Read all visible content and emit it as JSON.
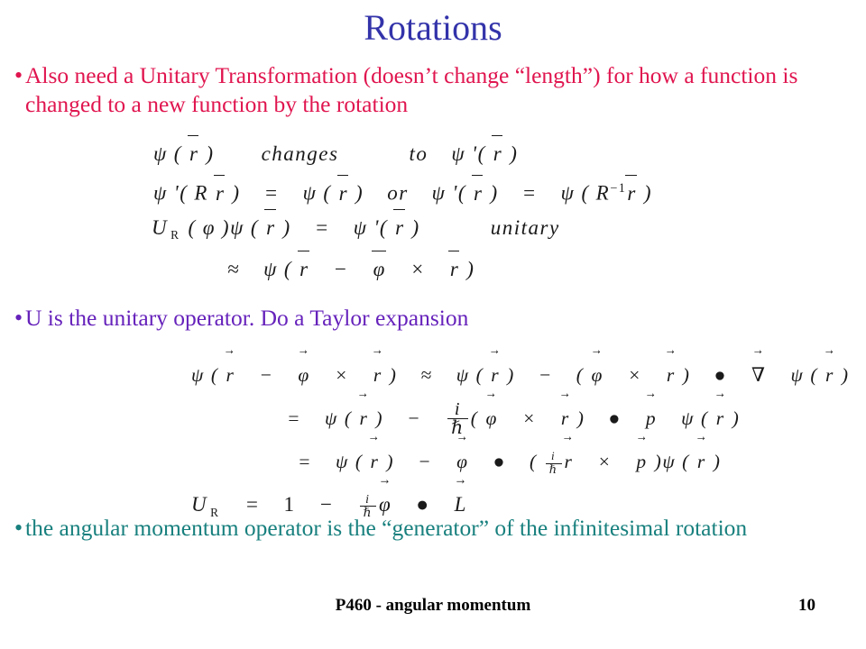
{
  "slide": {
    "title": "Rotations",
    "title_color": "#3333AA",
    "background_color": "#FFFFFF",
    "page_number": "10",
    "footer": "P460 - angular momentum"
  },
  "bullets": [
    {
      "marker": "•",
      "color": "#E0154F",
      "text": "Also need a Unitary Transformation (doesn’t change “length”) for how a function is changed to a new function by the rotation"
    },
    {
      "marker": "•",
      "color": "#6622BB",
      "text": "U is the unitary operator. Do a Taylor expansion"
    },
    {
      "marker": "•",
      "color": "#18807E",
      "text": "the angular momentum operator is the “generator” of the infinitesimal rotation"
    }
  ],
  "equation_block_1": {
    "color": "#1A1A1A",
    "lines": [
      "ψ ( r̅ )  changes   to  ψ '( r̅ )",
      "ψ '( R r̅ ) = ψ ( r̅ ) or ψ '( r̅ ) = ψ ( R ⁻¹ r̅ )",
      "U R ( φ )ψ ( r̅ ) = ψ '( r̅ )   unitary",
      "≈ ψ ( r̅ − φ̅ × r̅ )"
    ],
    "symbols": {
      "psi": "ψ",
      "phi": "φ",
      "r": "r",
      "approx": "≈",
      "times": "×",
      "minus": "−",
      "equals": "=",
      "prime": "'",
      "inverse_exponent": "− 1",
      "subscript_R": "R",
      "word_changes": "changes",
      "word_to": "to",
      "word_or": "or",
      "word_unitary": "unitary"
    }
  },
  "equation_block_2": {
    "color": "#1A1A1A",
    "lines": [
      "ψ ( r⃗ − φ⃗ × r⃗ ) ≈ ψ ( r⃗ ) − ( φ⃗ × r⃗ ) • ∇⃗ ψ ( r⃗ )",
      "= ψ ( r⃗ ) − (i/ħ)( φ⃗ × r⃗ ) • p⃗ ψ ( r⃗ )",
      "= ψ ( r⃗ ) − φ⃗ • ( (i/ħ) r⃗ × p⃗ )ψ ( r⃗ )",
      "U R = 1 − (i/ħ) φ⃗ • L⃗"
    ],
    "symbols": {
      "psi": "ψ",
      "phi": "φ",
      "r": "r",
      "p": "p",
      "L": "L",
      "U": "U",
      "one": "1",
      "i": "i",
      "hbar": "ħ",
      "nabla": "∇",
      "dot": "•",
      "times": "×",
      "minus": "−",
      "approx": "≈",
      "equals": "=",
      "subscript_R": "R"
    }
  }
}
